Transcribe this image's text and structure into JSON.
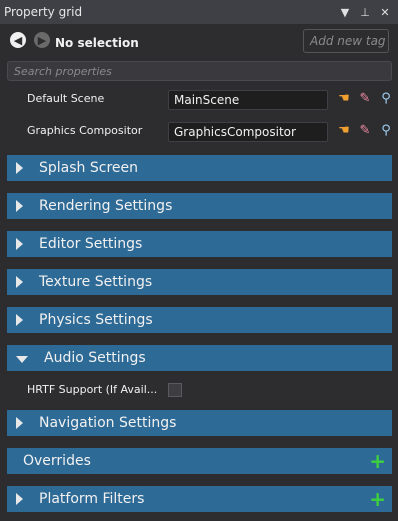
{
  "window": {
    "title": "Property grid"
  },
  "toolbar": {
    "selection_label": "No selection",
    "tag_placeholder": "Add new tag"
  },
  "search": {
    "placeholder": "Search properties"
  },
  "properties": [
    {
      "label": "Default Scene",
      "value": "MainScene"
    },
    {
      "label": "Graphics Compositor",
      "value": "GraphicsCompositor"
    }
  ],
  "sections": {
    "splash": "Splash Screen",
    "rendering": "Rendering Settings",
    "editor": "Editor Settings",
    "texture": "Texture Settings",
    "physics": "Physics Settings",
    "audio": "Audio Settings",
    "navigation": "Navigation Settings",
    "overrides": "Overrides",
    "platform": "Platform Filters"
  },
  "audio_props": {
    "hrtf_label": "HRTF Support (If Avail..."
  },
  "colors": {
    "section_bg": "#2e6a96",
    "panel_bg": "#2d2d30",
    "add_green": "#3dd13d"
  }
}
